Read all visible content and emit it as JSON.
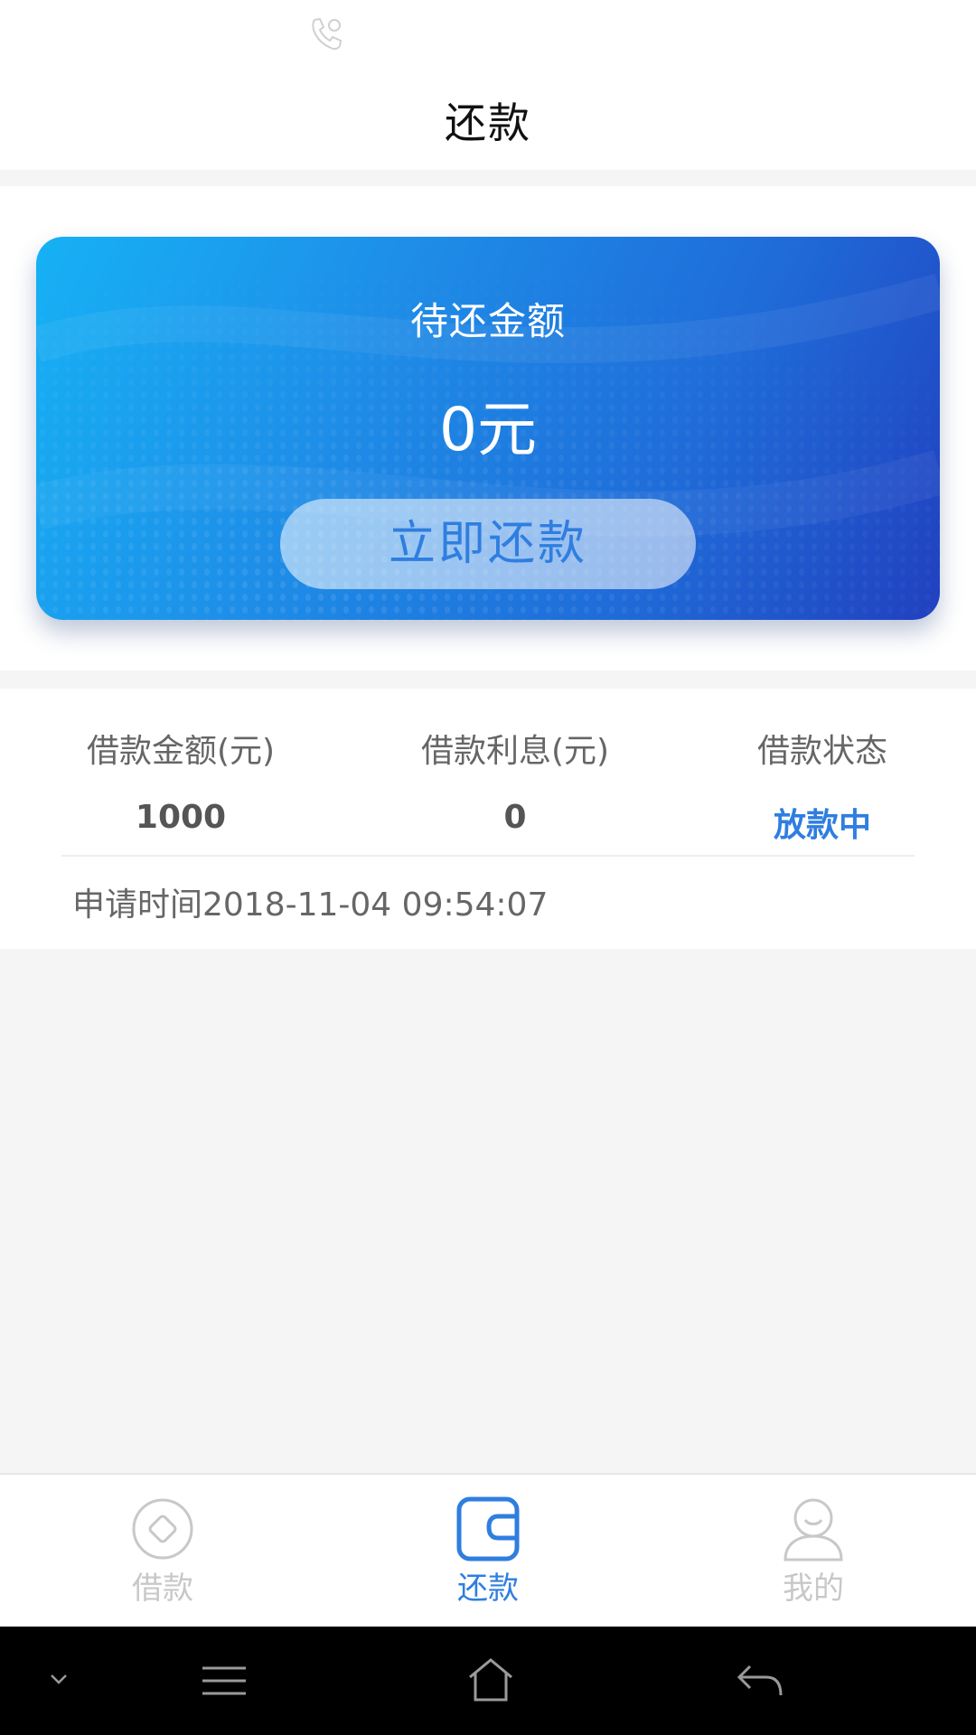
{
  "header": {
    "title": "还款"
  },
  "card": {
    "label": "待还金额",
    "amount": "0元",
    "button_label": "立即还款"
  },
  "loan": {
    "headers": [
      "借款金额(元)",
      "借款利息(元)",
      "借款状态"
    ],
    "values": [
      "1000",
      "0",
      "放款中"
    ],
    "apply_time": "申请时间2018-11-04 09:54:07"
  },
  "tabs": [
    {
      "label": "借款",
      "icon": "diamond-circle-icon",
      "active": false
    },
    {
      "label": "还款",
      "icon": "wallet-icon",
      "active": true
    },
    {
      "label": "我的",
      "icon": "user-icon",
      "active": false
    }
  ],
  "system_nav": [
    "chevron-down-icon",
    "menu-icon",
    "home-icon",
    "back-icon"
  ],
  "colors": {
    "accent": "#2f7ee0",
    "inactive": "#c8c8c8",
    "card_start": "#16b1f5",
    "card_end": "#2140c0"
  }
}
